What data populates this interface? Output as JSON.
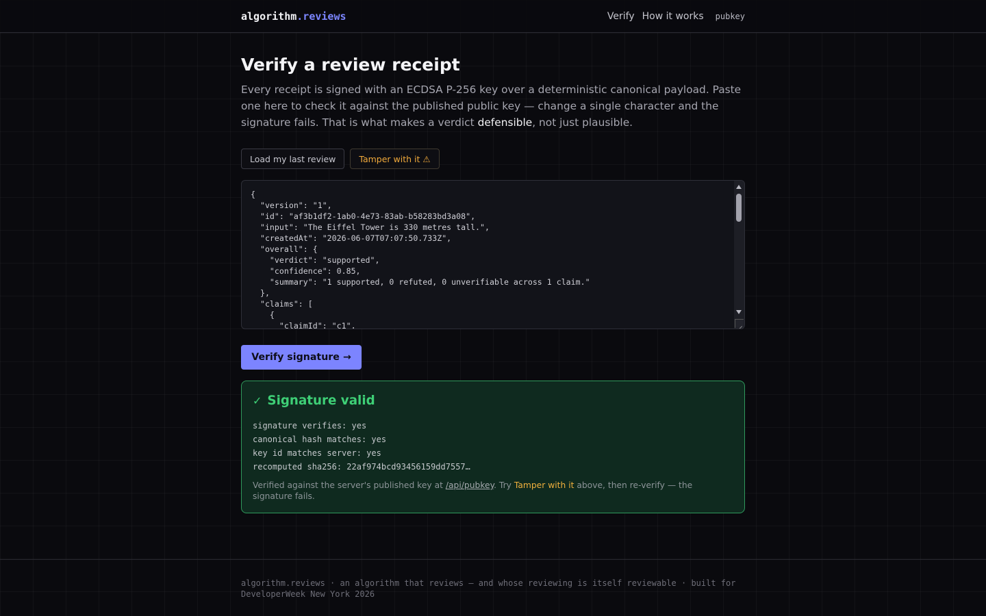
{
  "header": {
    "brand_main": "algorithm",
    "brand_accent": ".reviews",
    "nav": {
      "verify": "Verify",
      "how_it_works": "How it works",
      "pubkey": "pubkey"
    }
  },
  "page": {
    "title": "Verify a review receipt",
    "lede_part1": "Every receipt is signed with an ECDSA P-256 key over a deterministic canonical payload. Paste one here to check it against the published public key — change a single character and the signature fails. That is what makes a verdict ",
    "lede_strong": "defensible",
    "lede_part2": ", not just plausible."
  },
  "actions": {
    "load_last": "Load my last review",
    "tamper": "Tamper with it ⚠"
  },
  "editor": {
    "content": "{\n  \"version\": \"1\",\n  \"id\": \"af3b1df2-1ab0-4e73-83ab-b58283bd3a08\",\n  \"input\": \"The Eiffel Tower is 330 metres tall.\",\n  \"createdAt\": \"2026-06-07T07:07:50.733Z\",\n  \"overall\": {\n    \"verdict\": \"supported\",\n    \"confidence\": 0.85,\n    \"summary\": \"1 supported, 0 refuted, 0 unverifiable across 1 claim.\"\n  },\n  \"claims\": [\n    {\n      \"claimId\": \"c1\","
  },
  "verify_button": "Verify signature →",
  "result": {
    "check_icon": "✓",
    "title": "Signature valid",
    "lines": [
      "signature verifies: yes",
      "canonical hash matches: yes",
      "key id matches server: yes",
      "recomputed sha256: 22af974bcd93456159dd7557…"
    ],
    "note_part1": "Verified against the server's published key at ",
    "note_link": "/api/pubkey",
    "note_part2": ". Try ",
    "note_highlight": "Tamper with it",
    "note_part3": " above, then re-verify — the signature fails."
  },
  "footer": {
    "text": "algorithm.reviews · an algorithm that reviews — and whose reviewing is itself reviewable · built for DeveloperWeek New York 2026"
  },
  "colors": {
    "accent": "#7c84ff",
    "success": "#3ecf76",
    "warning": "#f0a93b",
    "background": "#0a0a0e"
  }
}
